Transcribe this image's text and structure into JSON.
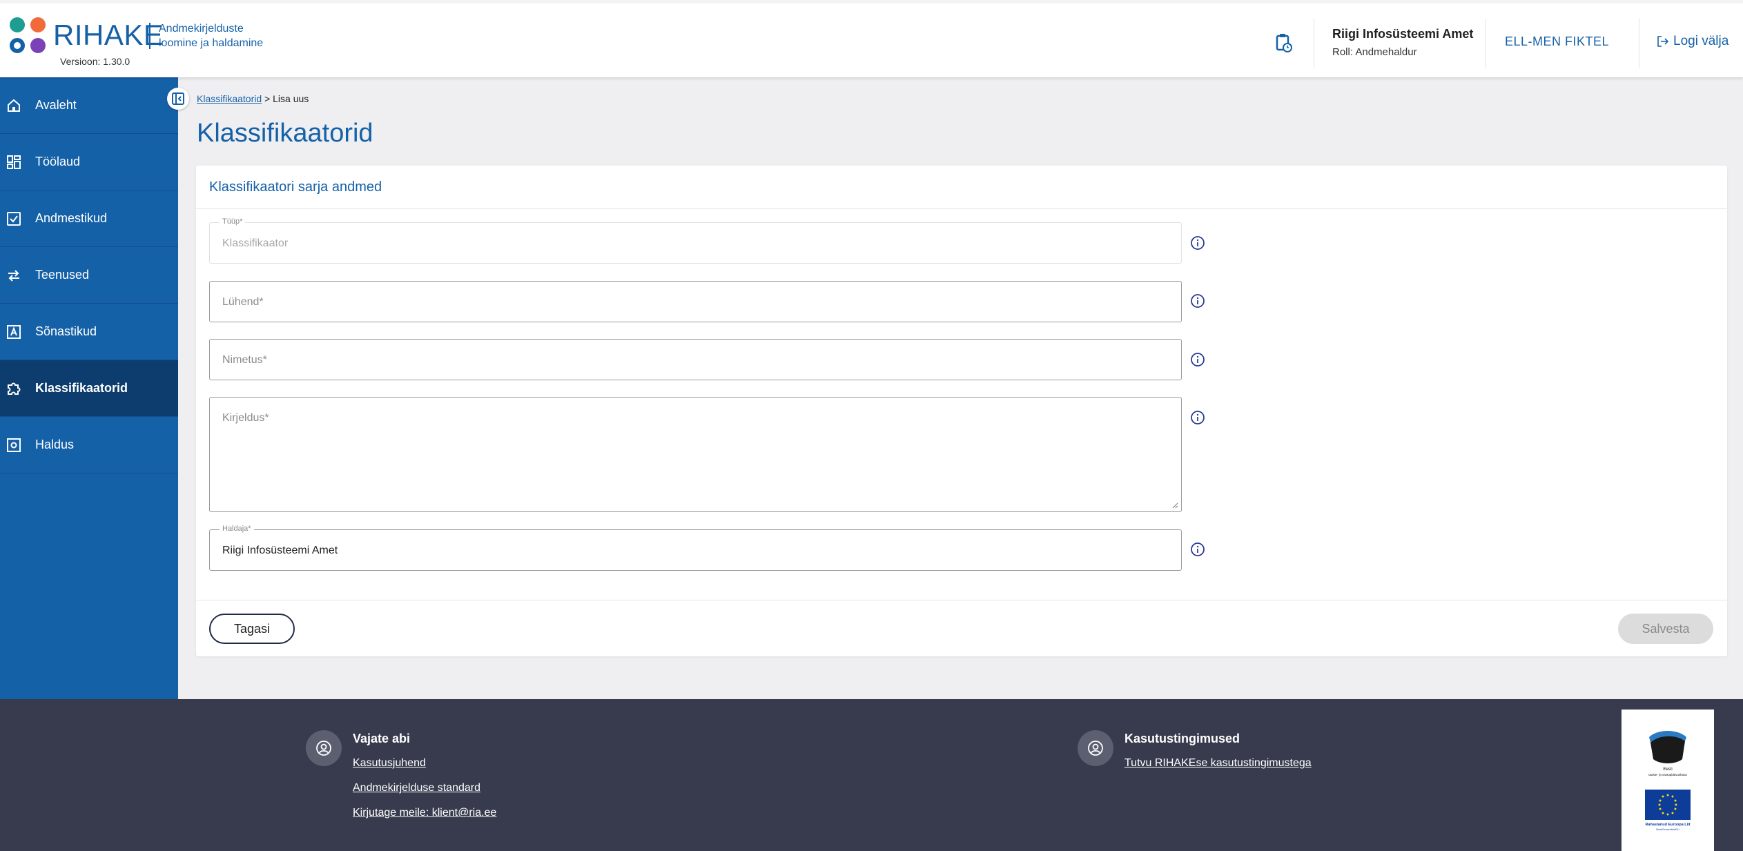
{
  "header": {
    "logo_text": "RIHAKE",
    "logo_subtitle_1": "Andmekirjelduste",
    "logo_subtitle_2": "loomine ja haldamine",
    "version": "Versioon: 1.30.0",
    "org_name": "Riigi Infosüsteemi Amet",
    "role": "Roll: Andmehaldur",
    "language_button": "ELL-MEN  FIKTEL",
    "logout_label": "Logi välja"
  },
  "sidebar": {
    "items": [
      {
        "label": "Avaleht",
        "icon": "home-icon"
      },
      {
        "label": "Töölaud",
        "icon": "dashboard-icon"
      },
      {
        "label": "Andmestikud",
        "icon": "checkbox-icon"
      },
      {
        "label": "Teenused",
        "icon": "swap-arrows-icon"
      },
      {
        "label": "Sõnastikud",
        "icon": "dictionary-icon"
      },
      {
        "label": "Klassifikaatorid",
        "icon": "puzzle-icon",
        "active": true
      },
      {
        "label": "Haldus",
        "icon": "settings-box-icon"
      }
    ]
  },
  "breadcrumb": {
    "link": "Klassifikaatorid",
    "separator": " > ",
    "current": "Lisa uus"
  },
  "page_title": "Klassifikaatorid",
  "form": {
    "section_title": "Klassifikaatori sarja andmed",
    "type_label": "Tüüp*",
    "type_value": "Klassifikaator",
    "abbrev_placeholder": "Lühend*",
    "name_placeholder": "Nimetus*",
    "description_placeholder": "Kirjeldus*",
    "owner_label": "Haldaja*",
    "owner_value": "Riigi Infosüsteemi Amet",
    "back_button": "Tagasi",
    "save_button": "Salvesta"
  },
  "footer": {
    "help_title": "Vajate abi",
    "help_links": [
      "Kasutusjuhend",
      "Andmekirjelduse standard",
      "Kirjutage meile: klient@ria.ee"
    ],
    "terms_title": "Kasutustingimused",
    "terms_link": "Tutvu RIHAKEse kasutustingimustega",
    "eu_logo_text_1": "Eesti",
    "eu_logo_text_2": "taaste- ja vastupidavuskava",
    "eu_logo_text_3": "Rahastanud Euroopa Liit",
    "eu_logo_text_4": "NextGenerationEU"
  },
  "colors": {
    "brand_blue": "#1561a8",
    "sidebar_active": "#0c3d6e",
    "footer_bg": "#373b4d",
    "page_bg": "#efeff1"
  }
}
